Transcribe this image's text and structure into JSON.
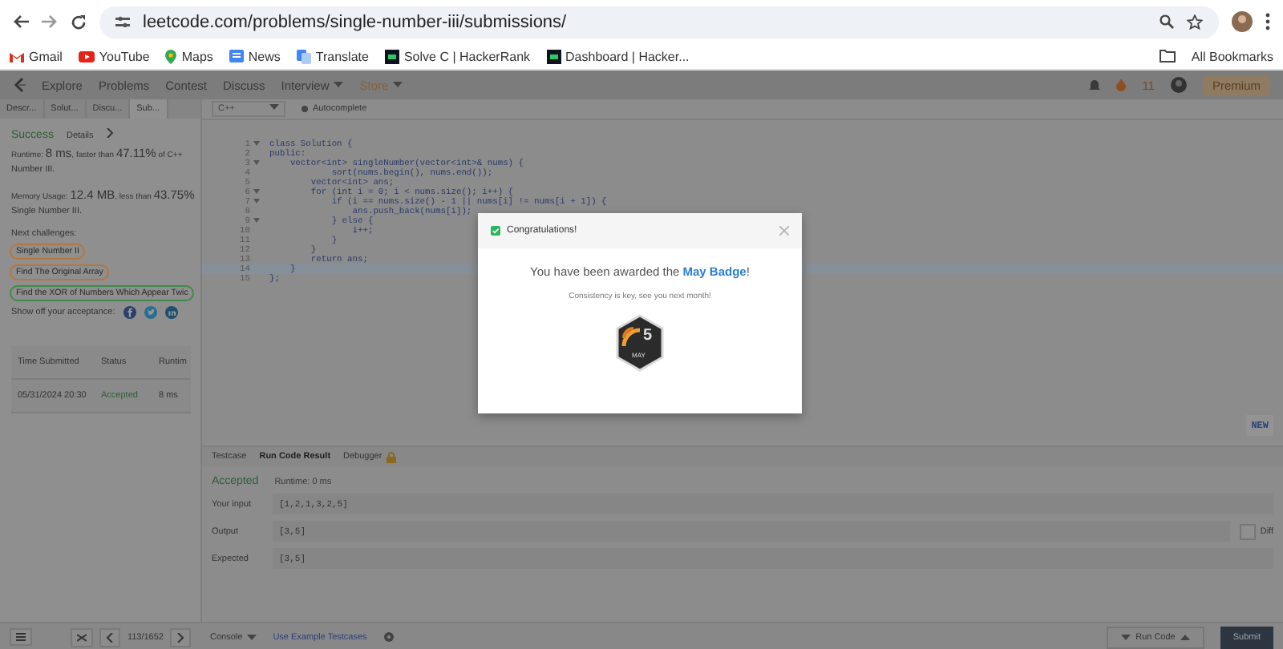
{
  "browser": {
    "url": "leetcode.com/problems/single-number-iii/submissions/",
    "bookmarks": [
      {
        "label": "Gmail",
        "kind": "gmail"
      },
      {
        "label": "YouTube",
        "kind": "youtube"
      },
      {
        "label": "Maps",
        "kind": "maps"
      },
      {
        "label": "News",
        "kind": "news"
      },
      {
        "label": "Translate",
        "kind": "translate"
      },
      {
        "label": "Solve C | HackerRank",
        "kind": "hackerrank"
      },
      {
        "label": "Dashboard | Hacker...",
        "kind": "hackerrank"
      }
    ],
    "all_bookmarks": "All Bookmarks"
  },
  "nav": {
    "items": [
      {
        "label": "Explore",
        "kind": "link"
      },
      {
        "label": "Problems",
        "kind": "link"
      },
      {
        "label": "Contest",
        "kind": "link"
      },
      {
        "label": "Discuss",
        "kind": "link"
      },
      {
        "label": "Interview",
        "kind": "dropdown"
      },
      {
        "label": "Store",
        "kind": "store"
      }
    ],
    "streak": "11",
    "premium": "Premium"
  },
  "left": {
    "tabs": [
      {
        "label": "Descr...",
        "selected": false
      },
      {
        "label": "Solut...",
        "selected": false
      },
      {
        "label": "Discu...",
        "selected": false
      },
      {
        "label": "Sub...",
        "selected": true
      }
    ],
    "status": "Success",
    "details": "Details",
    "runtime": "Runtime: **8 ms**, faster than **47.11%** of C++",
    "runtime_sub": "Number III.",
    "memory": "Memory Usage: **12.4 MB**, less than **43.75%**",
    "memory_sub": "Single Number III.",
    "next_label": "Next challenges:",
    "challenges": [
      {
        "label": "Single Number II",
        "color": "#b8763a"
      },
      {
        "label": "Find The Original Array",
        "color": "#b8763a"
      },
      {
        "label": "Find the XOR of Numbers Which Appear Twic",
        "color": "#3f8a4a"
      }
    ],
    "share_label": "Show off your acceptance:",
    "table": {
      "columns": [
        "Time Submitted",
        "Status",
        "Runtim"
      ],
      "rows": [
        {
          "cells": [
            "05/31/2024 20:30",
            "Accepted",
            "8 ms"
          ]
        }
      ]
    }
  },
  "editor": {
    "language": "C++",
    "autocomplete": "Autocomplete",
    "lines": [
      {
        "number": "1",
        "text": "class Solution {",
        "foldable": true,
        "highlighted": false
      },
      {
        "number": "2",
        "text": "public:",
        "foldable": false,
        "highlighted": false
      },
      {
        "number": "3",
        "text": "    vector<int> singleNumber(vector<int>& nums) {",
        "foldable": true,
        "highlighted": false
      },
      {
        "number": "4",
        "text": "            sort(nums.begin(), nums.end());",
        "foldable": false,
        "highlighted": false
      },
      {
        "number": "5",
        "text": "        vector<int> ans;",
        "foldable": false,
        "highlighted": false
      },
      {
        "number": "6",
        "text": "        for (int i = 0; i < nums.size(); i++) {",
        "foldable": true,
        "highlighted": false
      },
      {
        "number": "7",
        "text": "            if (i == nums.size() - 1 || nums[i] != nums[i + 1]) {",
        "foldable": true,
        "highlighted": false
      },
      {
        "number": "8",
        "text": "                ans.push_back(nums[i]);",
        "foldable": false,
        "highlighted": false
      },
      {
        "number": "9",
        "text": "            } else {",
        "foldable": true,
        "highlighted": false
      },
      {
        "number": "10",
        "text": "                i++;",
        "foldable": false,
        "highlighted": false
      },
      {
        "number": "11",
        "text": "            }",
        "foldable": false,
        "highlighted": false
      },
      {
        "number": "12",
        "text": "        }",
        "foldable": false,
        "highlighted": false
      },
      {
        "number": "13",
        "text": "        return ans;",
        "foldable": false,
        "highlighted": false
      },
      {
        "number": "14",
        "text": "    }",
        "foldable": false,
        "highlighted": true
      },
      {
        "number": "15",
        "text": "};",
        "foldable": false,
        "highlighted": false
      }
    ],
    "new_badge": "NEW"
  },
  "console": {
    "tabs": [
      {
        "label": "Testcase",
        "selected": false,
        "locked": false
      },
      {
        "label": "Run Code Result",
        "selected": true,
        "locked": false
      },
      {
        "label": "Debugger",
        "selected": false,
        "locked": true
      }
    ],
    "status": "Accepted",
    "runtime": "Runtime: 0 ms",
    "fields": [
      {
        "label": "Your input",
        "value": "[1,2,1,3,2,5]"
      },
      {
        "label": "Output",
        "value": "[3,5]"
      },
      {
        "label": "Expected",
        "value": "[3,5]"
      }
    ],
    "diff": {
      "label": "Diff",
      "on": false
    }
  },
  "footer": {
    "pager": "113/1652",
    "console": "Console",
    "example": "Use Example Testcases",
    "run": "Run Code",
    "submit": "Submit"
  },
  "modal": {
    "title": "Congratulations!",
    "message": "You have been awarded the **May Badge**!",
    "note": "Consistency is key, see you next month!",
    "badge_number": "5",
    "badge_month": "MAY"
  }
}
